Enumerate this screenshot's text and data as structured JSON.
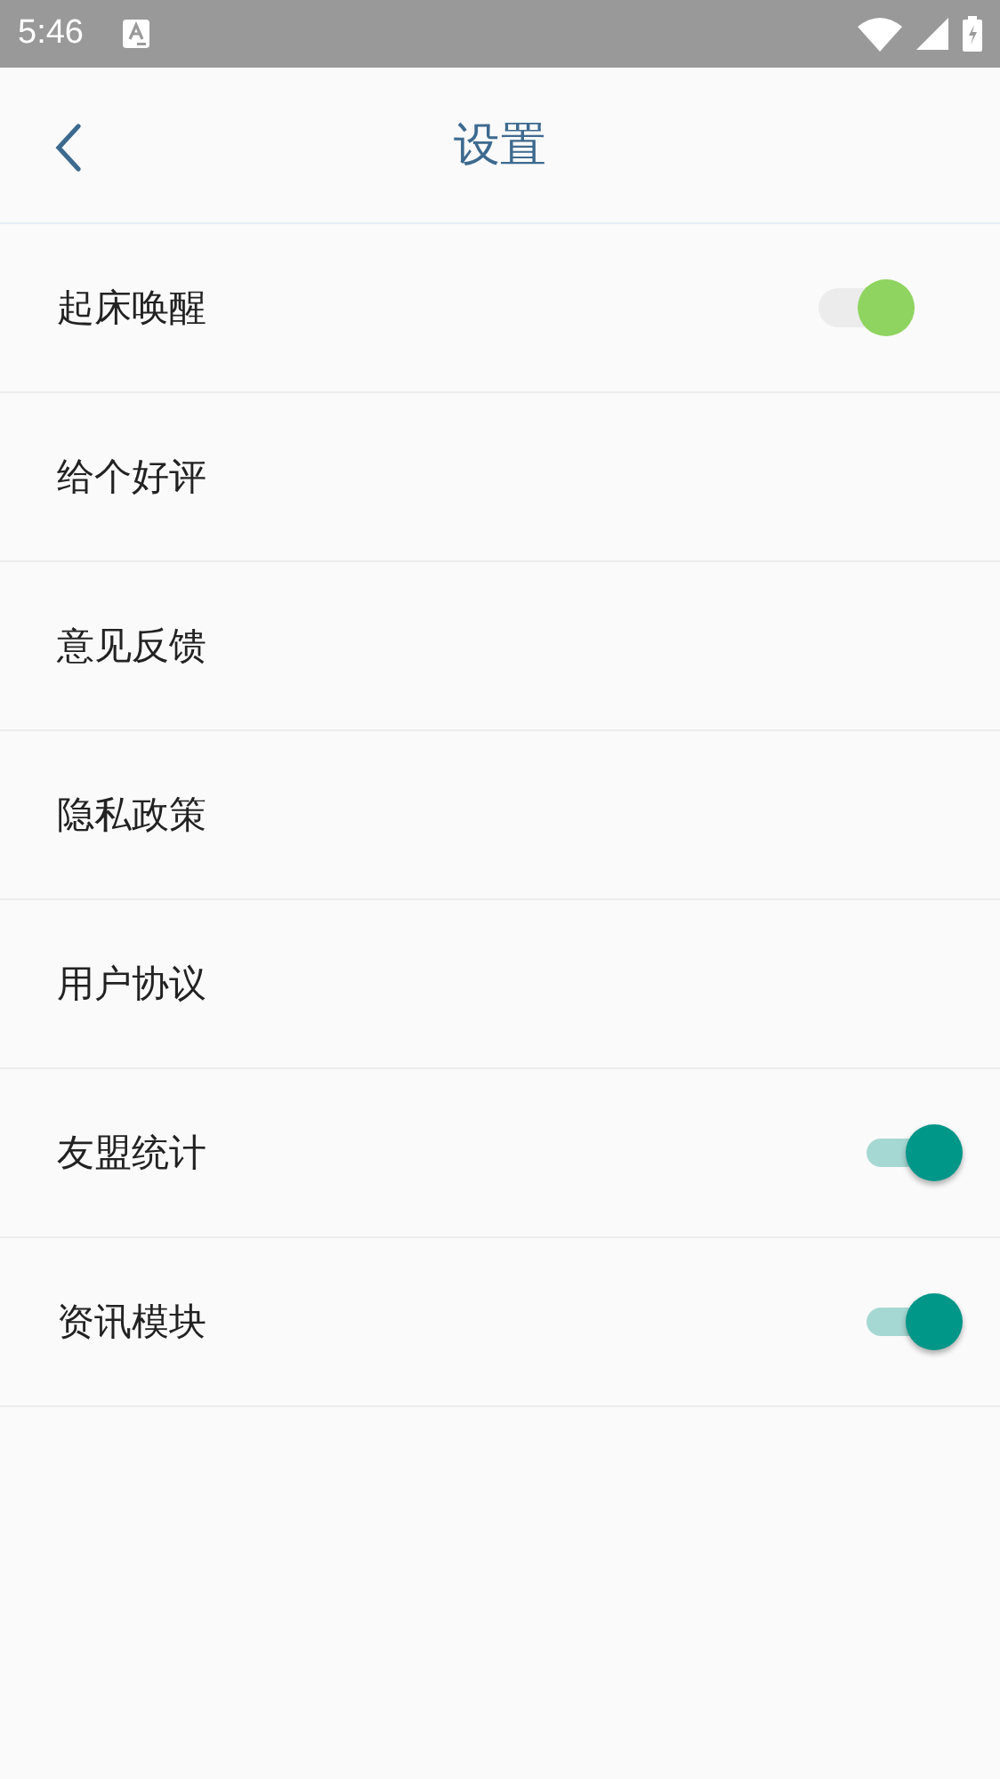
{
  "status_bar": {
    "time": "5:46"
  },
  "header": {
    "title": "设置"
  },
  "rows": [
    {
      "label": "起床唤醒",
      "kind": "compact-switch",
      "on": true,
      "color": "#8fd460"
    },
    {
      "label": "给个好评",
      "kind": "link"
    },
    {
      "label": "意见反馈",
      "kind": "link"
    },
    {
      "label": "隐私政策",
      "kind": "link"
    },
    {
      "label": "用户协议",
      "kind": "link"
    },
    {
      "label": "友盟统计",
      "kind": "switch",
      "on": true,
      "color": "#009688"
    },
    {
      "label": "资讯模块",
      "kind": "switch",
      "on": true,
      "color": "#009688"
    }
  ]
}
